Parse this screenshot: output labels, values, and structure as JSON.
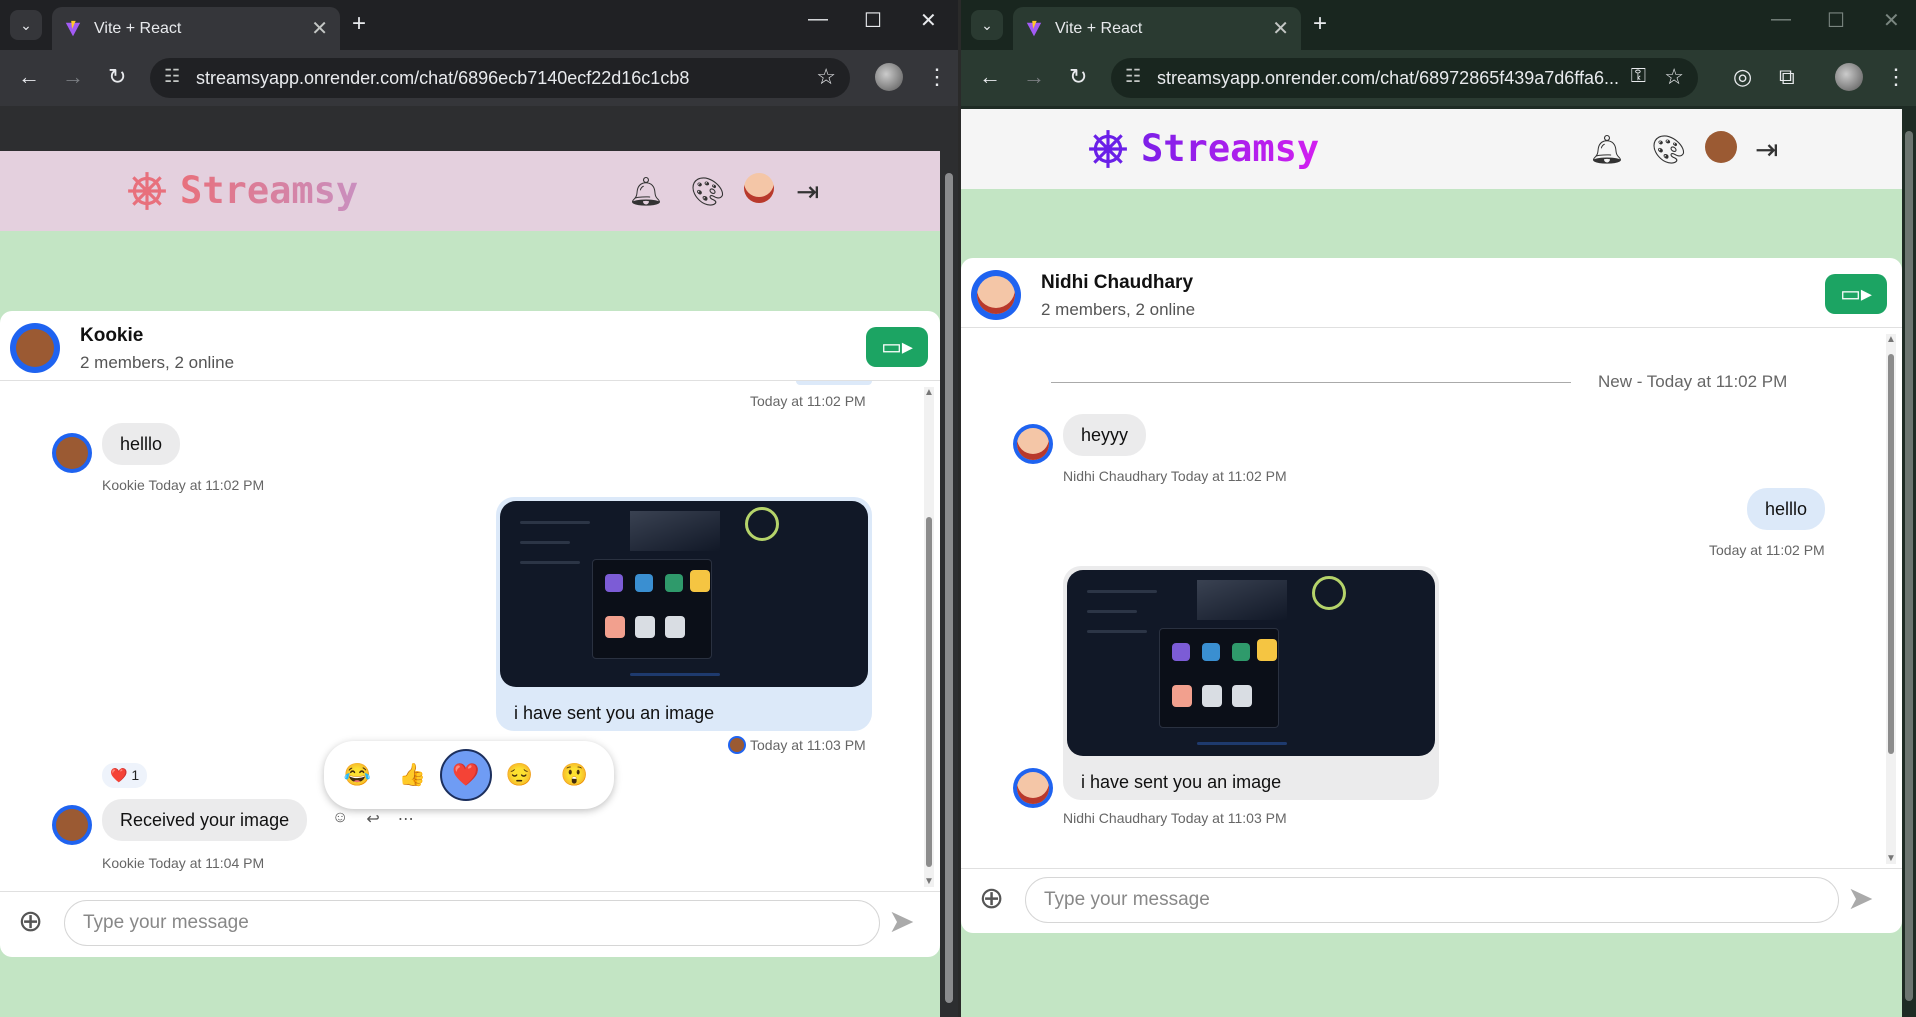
{
  "left": {
    "tab_title": "Vite + React",
    "url": "streamsyapp.onrender.com/chat/6896ecb7140ecf22d16c1cb8",
    "brand": "Streamsy",
    "chat": {
      "name": "Kookie",
      "subtitle": "2 members, 2 online",
      "prev_time": "Today at 11:02 PM",
      "msg1": {
        "text": "helllo",
        "meta": "Kookie Today at 11:02 PM"
      },
      "msg2": {
        "caption": "i have sent you an image",
        "meta": "Today at 11:03 PM"
      },
      "msg3": {
        "text": "Received your image",
        "meta": "Kookie Today at 11:04 PM",
        "reaction": "❤️",
        "reaction_count": "1"
      }
    },
    "reactions": [
      "😂",
      "👍",
      "❤️",
      "😔",
      "😲"
    ],
    "composer_placeholder": "Type your message"
  },
  "right": {
    "tab_title": "Vite + React",
    "url": "streamsyapp.onrender.com/chat/68972865f439a7d6ffa6...",
    "brand": "Streamsy",
    "chat": {
      "name": "Nidhi Chaudhary",
      "subtitle": "2 members, 2 online",
      "new_label": "New - Today at 11:02 PM",
      "msg1": {
        "text": "heyyy",
        "meta": "Nidhi Chaudhary Today at 11:02 PM"
      },
      "msg2": {
        "text": "helllo",
        "meta": "Today at 11:02 PM"
      },
      "msg3": {
        "caption": "i have sent you an image",
        "meta": "Nidhi Chaudhary Today at 11:03 PM"
      }
    },
    "composer_placeholder": "Type your message"
  },
  "icons": {
    "bell": "bell-icon",
    "palette": "palette-icon",
    "logout": "logout-icon",
    "video": "video-camera-icon",
    "send": "send-icon",
    "plus": "add-attachment-icon"
  },
  "colors": {
    "page_bg": "#c3e5c4",
    "left_header": "#e4d0de",
    "right_header": "#f5f5f5",
    "video_btn": "#1ca463",
    "avatar_bg": "#1f63f0",
    "selected_reaction": "#6f9cf4"
  }
}
